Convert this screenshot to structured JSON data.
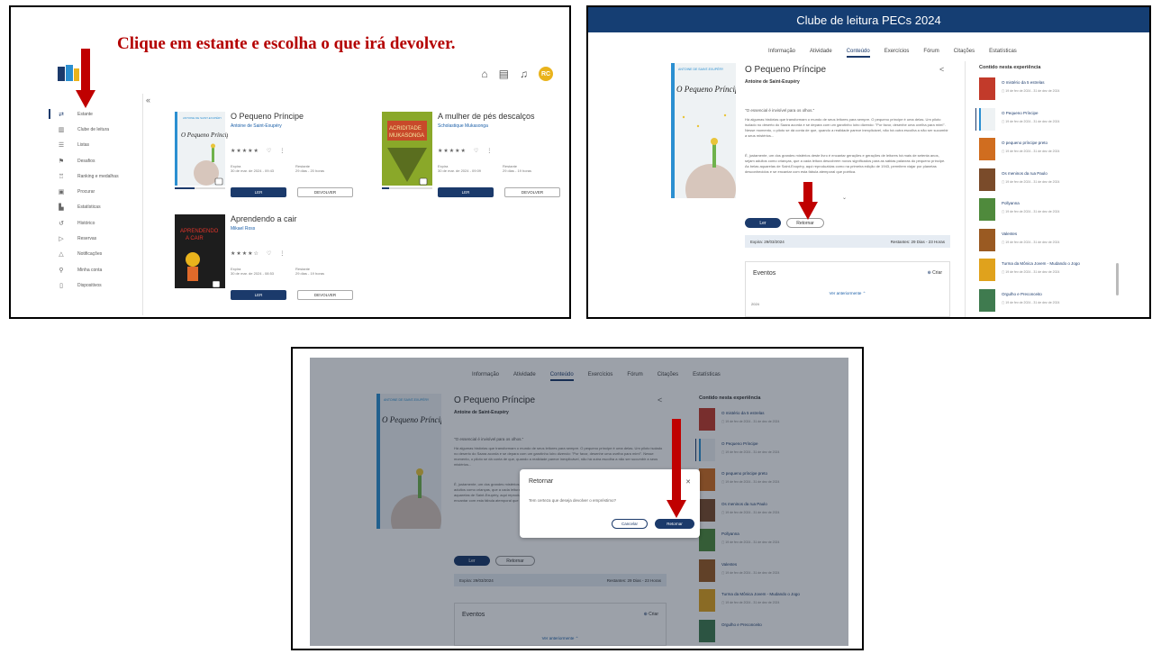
{
  "panel1": {
    "heading": "Clique em estante e escolha o que irá devolver.",
    "avatar_initials": "RC",
    "topbar_icons": [
      "home-icon",
      "bookmark-icon",
      "bell-icon"
    ],
    "sidebar": [
      {
        "label": "Estante",
        "icon": "shelf-icon",
        "active": true
      },
      {
        "label": "Clube de leitura",
        "icon": "book-icon"
      },
      {
        "label": "Listas",
        "icon": "list-icon"
      },
      {
        "label": "Desafios",
        "icon": "running-icon"
      },
      {
        "label": "Ranking e medalhas",
        "icon": "medal-icon"
      },
      {
        "label": "Procurar",
        "icon": "search-icon"
      },
      {
        "label": "Estatísticas",
        "icon": "chart-icon"
      },
      {
        "label": "Histórico",
        "icon": "history-icon"
      },
      {
        "label": "Reservas",
        "icon": "reserve-icon"
      },
      {
        "label": "Notificações",
        "icon": "bell-icon"
      },
      {
        "label": "Minha conta",
        "icon": "user-icon"
      },
      {
        "label": "Dispositivos",
        "icon": "device-icon"
      }
    ],
    "books": [
      {
        "title": "O Pequeno Príncipe",
        "author": "Antoine de Saint-Exupéry",
        "expiry_label": "Expira",
        "expiry": "30 de mar. de 2024 - 09:43",
        "remaining_label": "Restante",
        "remaining": "29 dias - 20 horas",
        "read": "LER",
        "return": "DEVOLVER",
        "progress": 0.4
      },
      {
        "title": "A mulher de pés descalços",
        "author": "Scholastique Mukasonga",
        "expiry_label": "Expira",
        "expiry": "30 de mar. de 2024 - 09:09",
        "remaining_label": "Restante",
        "remaining": "29 dias - 19 horas",
        "read": "LER",
        "return": "DEVOLVER",
        "progress": 0.15
      },
      {
        "title": "Aprendendo a cair",
        "author": "Mikael Ross",
        "expiry_label": "Expira",
        "expiry": "30 de mar. de 2024 - 08:53",
        "remaining_label": "Restante",
        "remaining": "29 dias - 19 horas",
        "read": "LER",
        "return": "DEVOLVER",
        "progress": 0
      }
    ]
  },
  "panel2": {
    "club_title": "Clube de leitura PECs 2024",
    "tabs": [
      "Informação",
      "Atividade",
      "Conteúdo",
      "Exercícios",
      "Fórum",
      "Citações",
      "Estatísticas"
    ],
    "active_tab": 2,
    "book_title": "O Pequeno Príncipe",
    "book_author": "Antoine de Saint-Exupéry",
    "cover_author": "ANTOINE DE SAINT-EXUPÉRY",
    "quote": "\"O essencial é invisível para os olhos.\"",
    "desc1": "Há algumas histórias que transformam o mundo de seus leitores para sempre. O pequeno príncipe é uma delas. Um piloto isolado no deserto do Saara acorda e se depara com um garotinho loiro dizendo: \"Por favor, desenhe uma ovelha para mim!\". Nesse momento, o piloto se dá conta de que, quando a realidade parece inexplicável, não há outra escolha a não ser sucumbir a seus mistérios...",
    "desc2": "É, justamente, um dos grandes mistérios deste livro é encantar gerações e gerações de leitores há mais de setenta anos, sejam adultos como crianças, que a cada leitura descobrem novos significados para as sábias palavras do pequeno príncipe. As belas aquarelas de Saint-Exupéry, aqui reproduzidas como na primeira edição de 1943, permitem viajar por planetas desconhecidos e se encantar com esta fábula atemporal que poética.",
    "read_label": "Ler",
    "return_label": "Retornar",
    "expiry": "Expira: 29/03/2024",
    "remaining": "Restantes: 29 Dias - 23 Horas",
    "events_title": "Eventos",
    "events_create": "Criar",
    "events_more": "Ver anteriormente",
    "events_year": "2024",
    "content_heading": "Contido nesta experiência",
    "content_items": [
      {
        "name": "O mistério da 5 estrelas",
        "date": "19 de fev de 2024 - 31 de dez de 2024",
        "color": "#c23a2a"
      },
      {
        "name": "O Pequeno Príncipe",
        "date": "19 de fev de 2024 - 31 de dez de 2024",
        "color": "#eef2f4",
        "selected": true
      },
      {
        "name": "O pequeno príncipe preto",
        "date": "19 de fev de 2024 - 31 de dez de 2024",
        "color": "#d06d1f"
      },
      {
        "name": "Os meninos da rua Paulo",
        "date": "19 de fev de 2024 - 31 de dez de 2024",
        "color": "#7a4b2a"
      },
      {
        "name": "Pollyanna",
        "date": "19 de fev de 2024 - 31 de dez de 2024",
        "color": "#4f8a3c"
      },
      {
        "name": "Valentes",
        "date": "19 de fev de 2024 - 31 de dez de 2024",
        "color": "#9a5a22"
      },
      {
        "name": "Turma da Mônica Jovem - Mudando o Jogo",
        "date": "19 de fev de 2024 - 31 de dez de 2024",
        "color": "#e0a21c"
      },
      {
        "name": "Orgulho e Preconceito",
        "date": "19 de fev de 2024 - 31 de dez de 2024",
        "color": "#3f7b4f"
      }
    ]
  },
  "panel3": {
    "dialog_title": "Retornar",
    "dialog_message": "Tem certeza que deseja devolver o empréstimo?",
    "cancel_label": "Cancelar",
    "confirm_label": "Retornar"
  },
  "colors": {
    "primary": "#1b3a6b",
    "club_bar": "#153e73",
    "heading_red": "#b40000",
    "arrow_red": "#c00000"
  }
}
